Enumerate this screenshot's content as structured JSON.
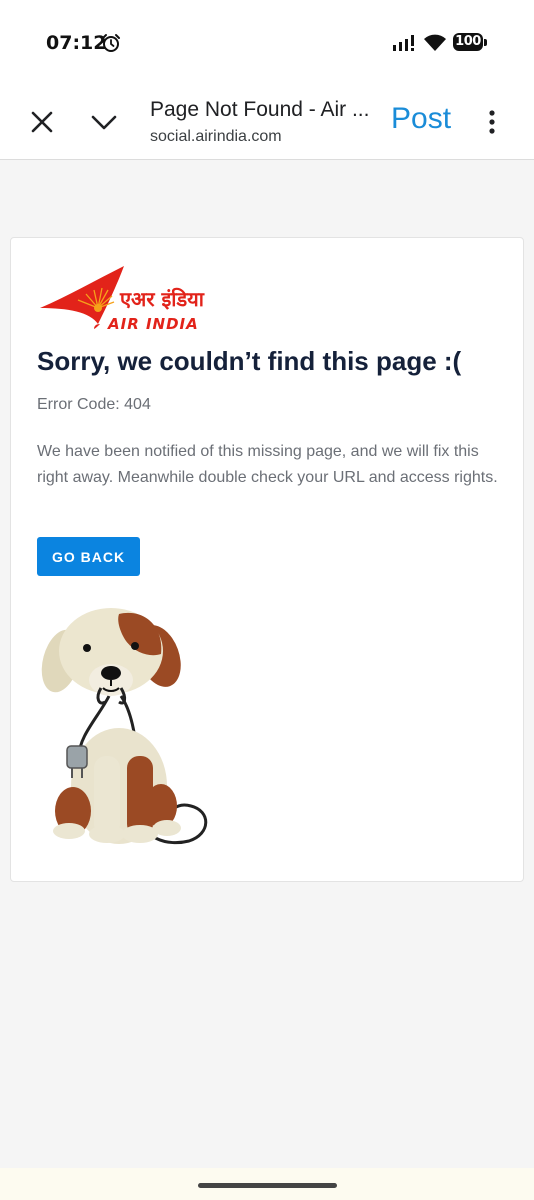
{
  "status_bar": {
    "time": "07:12",
    "battery": "100"
  },
  "toolbar": {
    "title": "Page Not Found - Air ...",
    "url": "social.airindia.com",
    "post_label": "Post"
  },
  "card": {
    "logo_text_hindi": "एअर इंडिया",
    "logo_text_english": "AIR INDIA",
    "heading": "Sorry, we couldn’t find this page :(",
    "error_code": "Error Code: 404",
    "message": "We have been notified of this missing page, and we will fix this right away. Meanwhile double check your URL and access rights.",
    "go_back_label": "GO BACK"
  },
  "colors": {
    "accent_blue": "#0b84e0",
    "post_blue": "#1a8cd8",
    "heading": "#15213a",
    "body_text": "#6b6f76",
    "brand_red": "#e2231a"
  },
  "icons": [
    "alarm-icon",
    "signal-icon",
    "wifi-icon",
    "battery-icon",
    "close-icon",
    "chevron-down-icon",
    "more-vert-icon",
    "air-india-logo",
    "dog-illustration"
  ]
}
